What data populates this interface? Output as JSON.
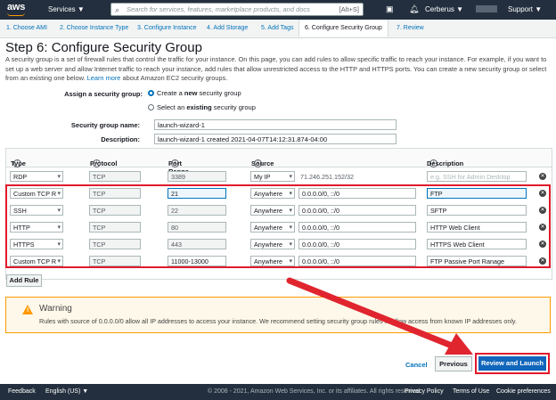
{
  "topbar": {
    "logo": "aws",
    "services_label": "Services ▼",
    "search_placeholder": "Search for services, features, marketplace products, and docs",
    "search_shortcut": "[Alt+S]",
    "user": "Cerberus ▼",
    "support": "Support ▼"
  },
  "steps": [
    {
      "label": "1. Choose AMI"
    },
    {
      "label": "2. Choose Instance Type"
    },
    {
      "label": "3. Configure Instance"
    },
    {
      "label": "4. Add Storage"
    },
    {
      "label": "5. Add Tags"
    },
    {
      "label": "6. Configure Security Group"
    },
    {
      "label": "7. Review"
    }
  ],
  "page": {
    "title": "Step 6: Configure Security Group",
    "intro": "A security group is a set of firewall rules that control the traffic for your instance. On this page, you can add rules to allow specific traffic to reach your instance. For example, if you want to set up a web server and allow Internet traffic to reach your instance, add rules that allow unrestricted access to the HTTP and HTTPS ports. You can create a new security group or select from an existing one below.",
    "learn_more": "Learn more",
    "intro_tail": "about Amazon EC2 security groups."
  },
  "form": {
    "assign_label": "Assign a security group:",
    "option_create_pre": "Create a ",
    "option_create_bold": "new",
    "option_create_post": " security group",
    "option_select_pre": "Select an ",
    "option_select_bold": "existing",
    "option_select_post": " security group",
    "name_label": "Security group name:",
    "name_value": "launch-wizard-1",
    "desc_label": "Description:",
    "desc_value": "launch-wizard-1 created 2021-04-07T14:12:31.874-04:00"
  },
  "table": {
    "headers": {
      "type": "Type",
      "protocol": "Protocol",
      "port": "Port Range",
      "source": "Source",
      "description": "Description"
    },
    "rows": [
      {
        "type": "RDP",
        "protocol": "TCP",
        "port": "3389",
        "source": "My IP",
        "cidr": "71.246.251.152/32",
        "description": "e.g. SSH for Admin Desktop"
      },
      {
        "type": "Custom TCP R",
        "protocol": "TCP",
        "port": "21",
        "source": "Anywhere",
        "cidr": "0.0.0.0/0, ::/0",
        "description": "FTP"
      },
      {
        "type": "SSH",
        "protocol": "TCP",
        "port": "22",
        "source": "Anywhere",
        "cidr": "0.0.0.0/0, ::/0",
        "description": "SFTP"
      },
      {
        "type": "HTTP",
        "protocol": "TCP",
        "port": "80",
        "source": "Anywhere",
        "cidr": "0.0.0.0/0, ::/0",
        "description": "HTTP Web Client"
      },
      {
        "type": "HTTPS",
        "protocol": "TCP",
        "port": "443",
        "source": "Anywhere",
        "cidr": "0.0.0.0/0, ::/0",
        "description": "HTTPS Web Client"
      },
      {
        "type": "Custom TCP R",
        "protocol": "TCP",
        "port": "11000-13000",
        "source": "Anywhere",
        "cidr": "0.0.0.0/0, ::/0",
        "description": "FTP Passive Port Ranage"
      }
    ],
    "add_rule": "Add Rule"
  },
  "warning": {
    "title": "Warning",
    "text": "Rules with source of 0.0.0.0/0 allow all IP addresses to access your instance. We recommend setting security group rules to allow access from known IP addresses only."
  },
  "actions": {
    "cancel": "Cancel",
    "previous": "Previous",
    "review": "Review and Launch"
  },
  "footer": {
    "feedback": "Feedback",
    "language": "English (US) ▼",
    "copyright": "© 2008 - 2021, Amazon Web Services, Inc. or its affiliates. All rights reserved.",
    "privacy": "Privacy Policy",
    "terms": "Terms of Use",
    "cookies": "Cookie preferences"
  },
  "colors": {
    "accent": "#0073bb",
    "highlight": "#e01a2b",
    "warning": "#ff9900",
    "header_bg": "#232f3e"
  }
}
